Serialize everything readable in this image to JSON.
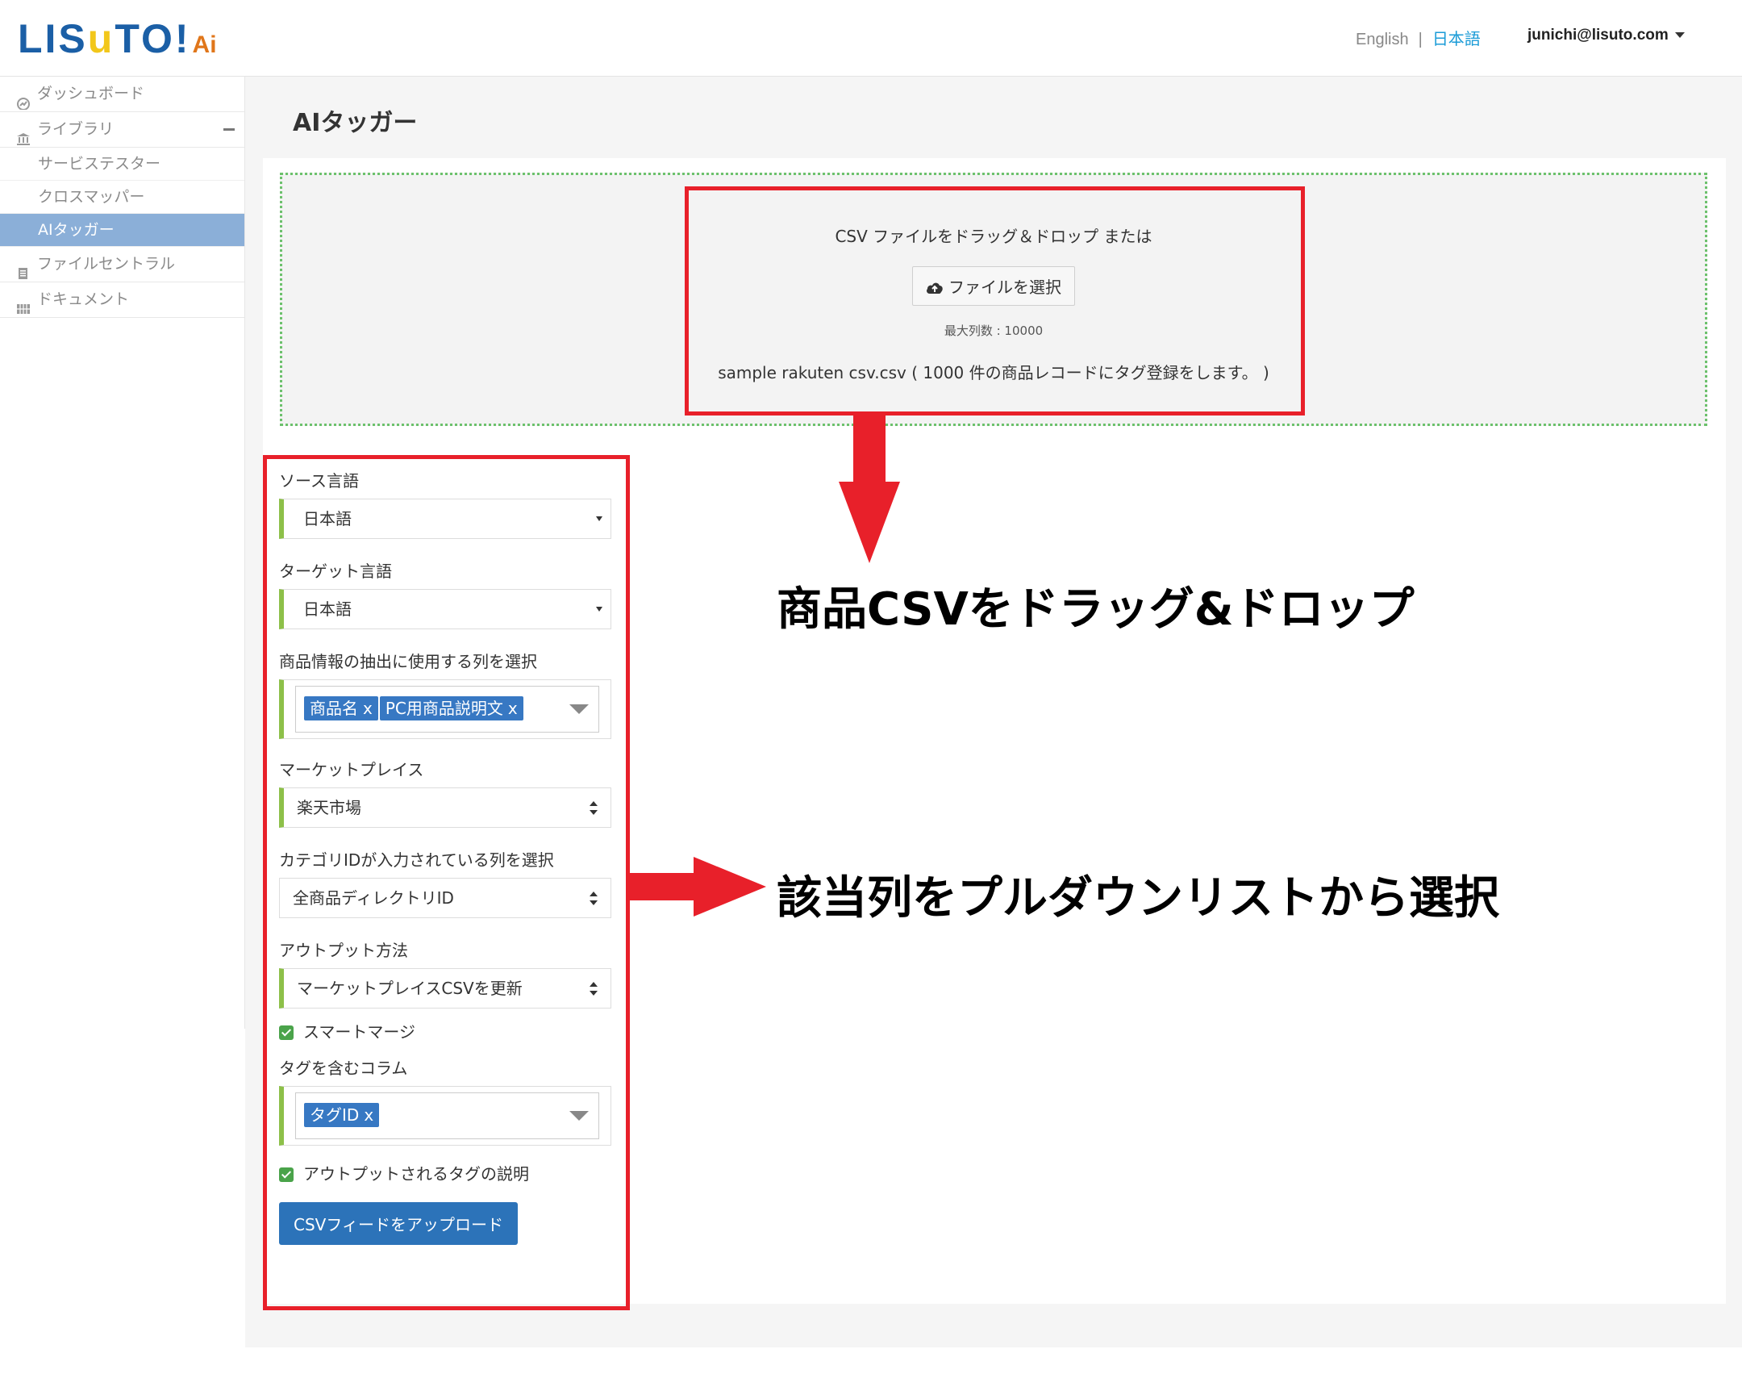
{
  "header": {
    "logo_main": "LIS",
    "logo_u": "u",
    "logo_end": "TO!",
    "logo_ai": "Ai",
    "lang_en": "English",
    "lang_sep": "|",
    "lang_ja": "日本語",
    "user": "junichi@lisuto.com"
  },
  "sidebar": {
    "items": [
      {
        "label": "ダッシュボード"
      },
      {
        "label": "ライブラリ"
      },
      {
        "label": "サービステスター"
      },
      {
        "label": "クロスマッパー"
      },
      {
        "label": "AIタッガー"
      },
      {
        "label": "ファイルセントラル"
      },
      {
        "label": "ドキュメント"
      }
    ]
  },
  "page": {
    "title": "AIタッガー"
  },
  "dropzone": {
    "line1": "CSV ファイルをドラッグ＆ドロップ または",
    "button": "ファイルを選択",
    "max": "最大列数 : 10000",
    "file": "sample rakuten csv.csv ( 1000 件の商品レコードにタグ登録をします。 )"
  },
  "form": {
    "source_label": "ソース言語",
    "source_value": "日本語",
    "target_label": "ターゲット言語",
    "target_value": "日本語",
    "columns_label": "商品情報の抽出に使用する列を選択",
    "columns_tags": [
      "商品名",
      "PC用商品説明文"
    ],
    "tag_x": "x",
    "marketplace_label": "マーケットプレイス",
    "marketplace_value": "楽天市場",
    "category_label": "カテゴリIDが入力されている列を選択",
    "category_value": "全商品ディレクトリID",
    "output_label": "アウトプット方法",
    "output_value": "マーケットプレイスCSVを更新",
    "smart_merge": "スマートマージ",
    "tag_columns_label": "タグを含むコラム",
    "tag_columns_tags": [
      "タグID"
    ],
    "tag_description": "アウトプットされるタグの説明",
    "upload_button": "CSVフィードをアップロード"
  },
  "annotations": {
    "drag_drop": "商品CSVをドラッグ&ドロップ",
    "pulldown": "該当列をプルダウンリストから選択",
    "accent_color": "#e8202a"
  }
}
